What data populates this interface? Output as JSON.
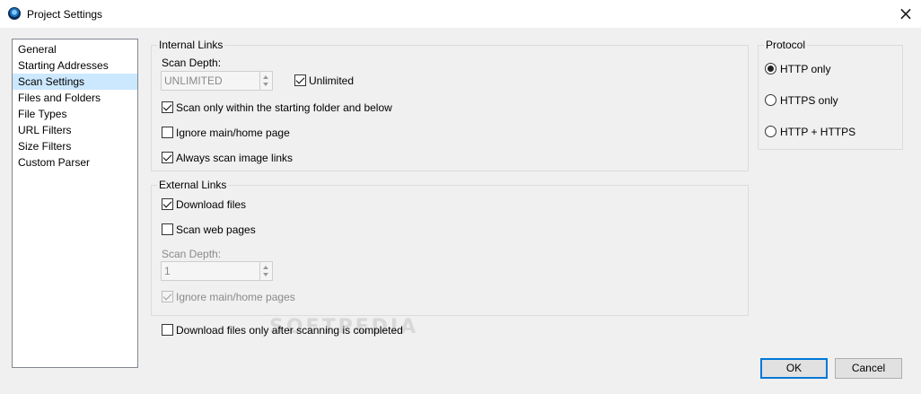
{
  "window": {
    "title": "Project Settings"
  },
  "nav": {
    "items": [
      {
        "label": "General",
        "selected": false
      },
      {
        "label": "Starting Addresses",
        "selected": false
      },
      {
        "label": "Scan Settings",
        "selected": true
      },
      {
        "label": "Files and Folders",
        "selected": false
      },
      {
        "label": "File Types",
        "selected": false
      },
      {
        "label": "URL Filters",
        "selected": false
      },
      {
        "label": "Size Filters",
        "selected": false
      },
      {
        "label": "Custom Parser",
        "selected": false
      }
    ]
  },
  "internal_links": {
    "title": "Internal Links",
    "scan_depth_label": "Scan Depth:",
    "scan_depth_value": "UNLIMITED",
    "unlimited": {
      "label": "Unlimited",
      "checked": true
    },
    "scan_within_folder": {
      "label": "Scan only within the starting folder and below",
      "checked": true
    },
    "ignore_main_page": {
      "label": "Ignore main/home page",
      "checked": false
    },
    "always_scan_images": {
      "label": "Always scan image links",
      "checked": true
    }
  },
  "external_links": {
    "title": "External Links",
    "download_files": {
      "label": "Download files",
      "checked": true
    },
    "scan_web_pages": {
      "label": "Scan web pages",
      "checked": false
    },
    "scan_depth_label": "Scan Depth:",
    "scan_depth_value": "1",
    "ignore_main_pages": {
      "label": "Ignore main/home pages",
      "checked": true,
      "disabled": true
    }
  },
  "download_after_scan": {
    "label": "Download files only after scanning is completed",
    "checked": false
  },
  "protocol": {
    "title": "Protocol",
    "options": [
      {
        "label": "HTTP only",
        "selected": true
      },
      {
        "label": "HTTPS only",
        "selected": false
      },
      {
        "label": "HTTP + HTTPS",
        "selected": false
      }
    ]
  },
  "buttons": {
    "ok": "OK",
    "cancel": "Cancel"
  },
  "watermark": "SOFTPEDIA"
}
